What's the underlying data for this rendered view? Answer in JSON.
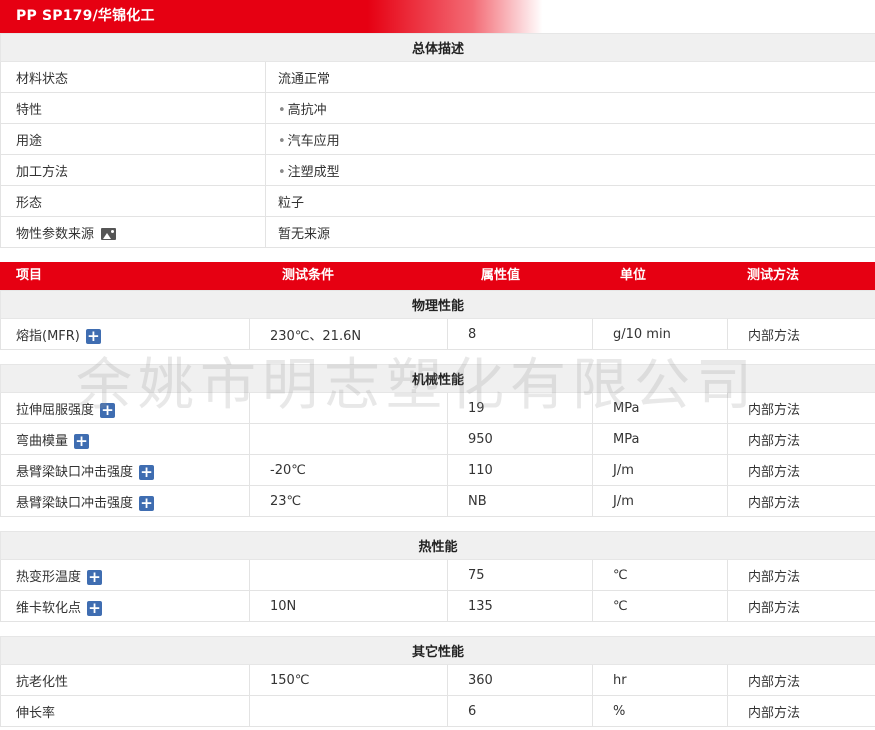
{
  "header": {
    "title": "PP SP179/华锦化工"
  },
  "overview": {
    "heading": "总体描述",
    "rows": [
      {
        "label": "材料状态",
        "value": "流通正常"
      },
      {
        "label": "特性",
        "value": "高抗冲",
        "bullet": "•"
      },
      {
        "label": "用途",
        "value": "汽车应用",
        "bullet": "•"
      },
      {
        "label": "加工方法",
        "value": "注塑成型",
        "bullet": "•"
      },
      {
        "label": "形态",
        "value": "粒子"
      },
      {
        "label": "物性参数来源",
        "value": "暂无来源"
      }
    ]
  },
  "columns": {
    "item": "项目",
    "condition": "测试条件",
    "value": "属性值",
    "unit": "单位",
    "method": "测试方法"
  },
  "sections": {
    "physical": {
      "heading": "物理性能",
      "rows": [
        {
          "item": "熔指(MFR)",
          "condition": "230℃、21.6N",
          "value": "8",
          "unit": "g/10 min",
          "method": "内部方法"
        }
      ]
    },
    "mechanical": {
      "heading": "机械性能",
      "rows": [
        {
          "item": "拉伸屈服强度",
          "condition": "",
          "value": "19",
          "unit": "MPa",
          "method": "内部方法"
        },
        {
          "item": "弯曲模量",
          "condition": "",
          "value": "950",
          "unit": "MPa",
          "method": "内部方法"
        },
        {
          "item": "悬臂梁缺口冲击强度",
          "condition": "-20℃",
          "value": "110",
          "unit": "J/m",
          "method": "内部方法"
        },
        {
          "item": "悬臂梁缺口冲击强度",
          "condition": "23℃",
          "value": "NB",
          "unit": "J/m",
          "method": "内部方法"
        }
      ]
    },
    "thermal": {
      "heading": "热性能",
      "rows": [
        {
          "item": "热变形温度",
          "condition": "",
          "value": "75",
          "unit": "℃",
          "method": "内部方法"
        },
        {
          "item": "维卡软化点",
          "condition": "10N",
          "value": "135",
          "unit": "℃",
          "method": "内部方法"
        }
      ]
    },
    "other": {
      "heading": "其它性能",
      "rows": [
        {
          "item": "抗老化性",
          "condition": "150℃",
          "value": "360",
          "unit": "hr",
          "method": "内部方法"
        },
        {
          "item": "伸长率",
          "condition": "",
          "value": "6",
          "unit": "%",
          "method": "内部方法"
        }
      ]
    }
  },
  "icons": {
    "expand": "plus-icon",
    "image": "image-icon",
    "plus_glyph": "+"
  },
  "watermark": "余姚市明志塑化有限公司",
  "colors": {
    "brand_red": "#e60012",
    "plus_blue": "#3f6db1",
    "section_bg": "#f0f0f0"
  }
}
